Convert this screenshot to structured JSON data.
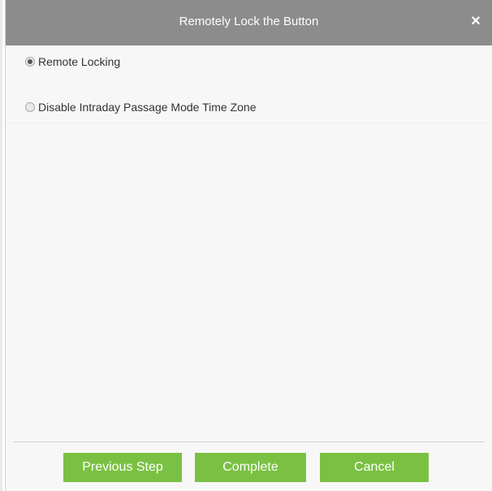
{
  "dialog": {
    "title": "Remotely Lock the Button",
    "close_symbol": "×"
  },
  "options": [
    {
      "label": "Remote Locking",
      "checked": true
    },
    {
      "label": "Disable Intraday Passage Mode Time Zone",
      "checked": false
    }
  ],
  "buttons": {
    "previous": "Previous Step",
    "complete": "Complete",
    "cancel": "Cancel"
  },
  "colors": {
    "titlebar": "#8c8c8c",
    "button": "#7ac143",
    "background": "#f7f7f7"
  }
}
